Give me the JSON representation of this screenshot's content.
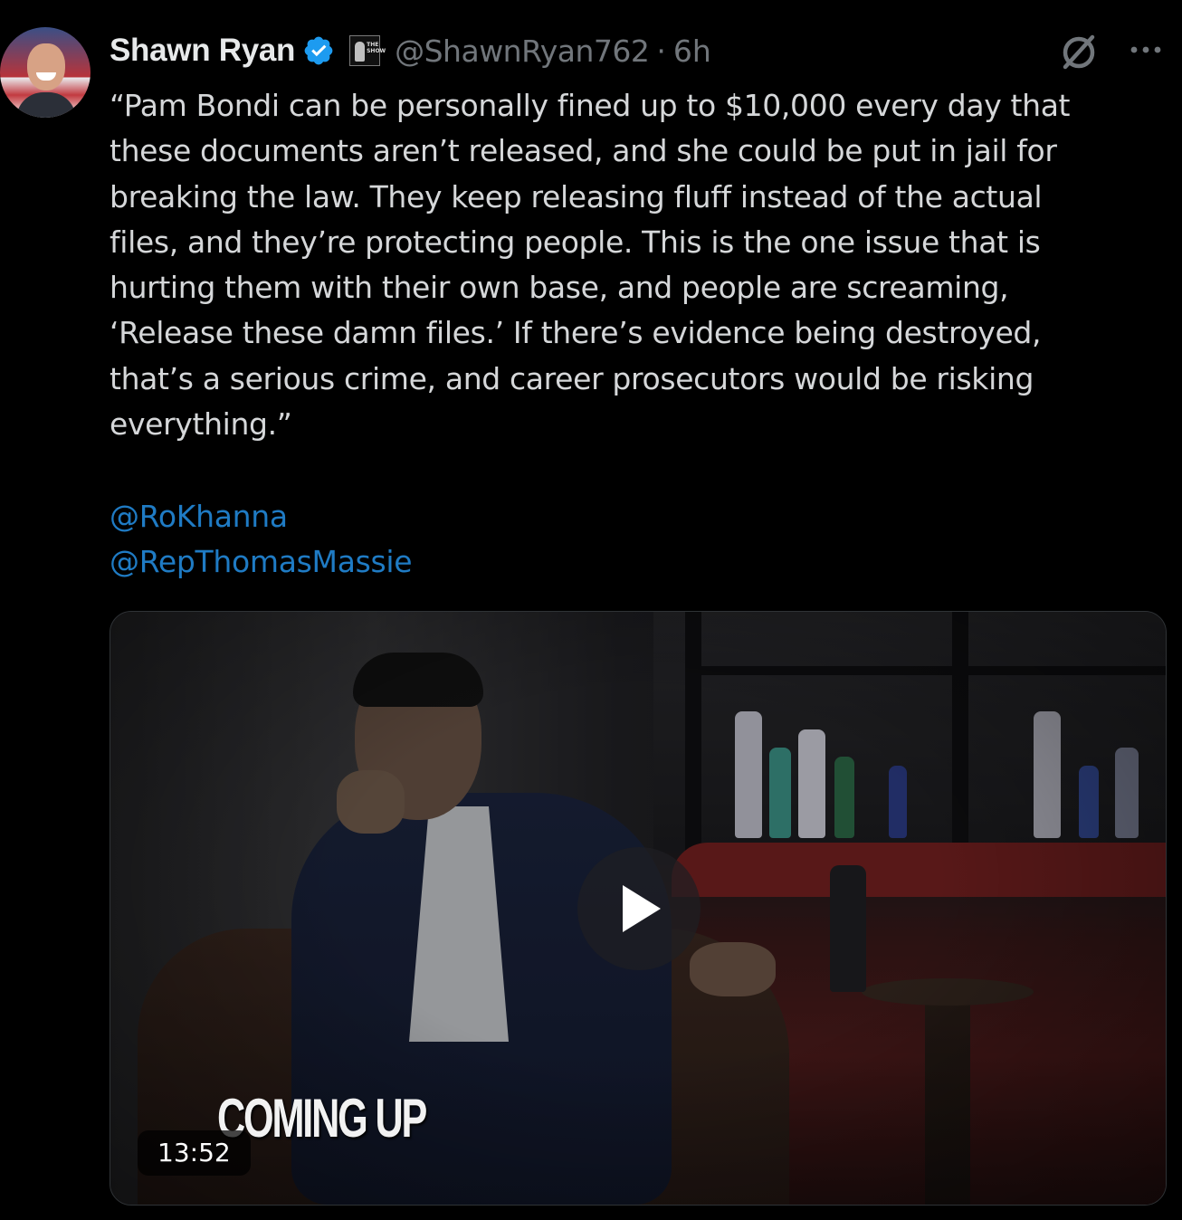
{
  "tweet": {
    "author": {
      "display_name": "Shawn Ryan",
      "verified_icon": "verified-badge-icon",
      "affiliate_badge": "affiliate-badge-icon",
      "affiliate_badge_text": "THE\nSHOW",
      "handle": "@ShawnRyan762",
      "separator": "·",
      "time": "6h"
    },
    "actions": {
      "grok_icon": "grok-icon",
      "more_icon": "more-icon"
    },
    "text": "“Pam Bondi can be personally fined up to $10,000 every day that\nthese documents aren’t released, and she could be put in jail for\nbreaking the law. They keep releasing fluff instead of the actual\nfiles, and they’re protecting people. This is the one issue that is\nhurting them with their own base, and people are screaming,\n‘Release these damn files.’ If there’s evidence being destroyed,\nthat’s a serious crime, and career prosecutors would be risking\neverything.”",
    "mentions": [
      "@RoKhanna",
      "@RepThomasMassie"
    ],
    "media": {
      "type": "video",
      "overlay_text": "COMING UP",
      "duration": "13:52",
      "play_icon": "play-icon"
    }
  },
  "colors": {
    "background": "#000000",
    "text": "#e7e9ea",
    "secondary": "#71767b",
    "link": "#1d9bf0",
    "verified": "#1d9bf0"
  }
}
